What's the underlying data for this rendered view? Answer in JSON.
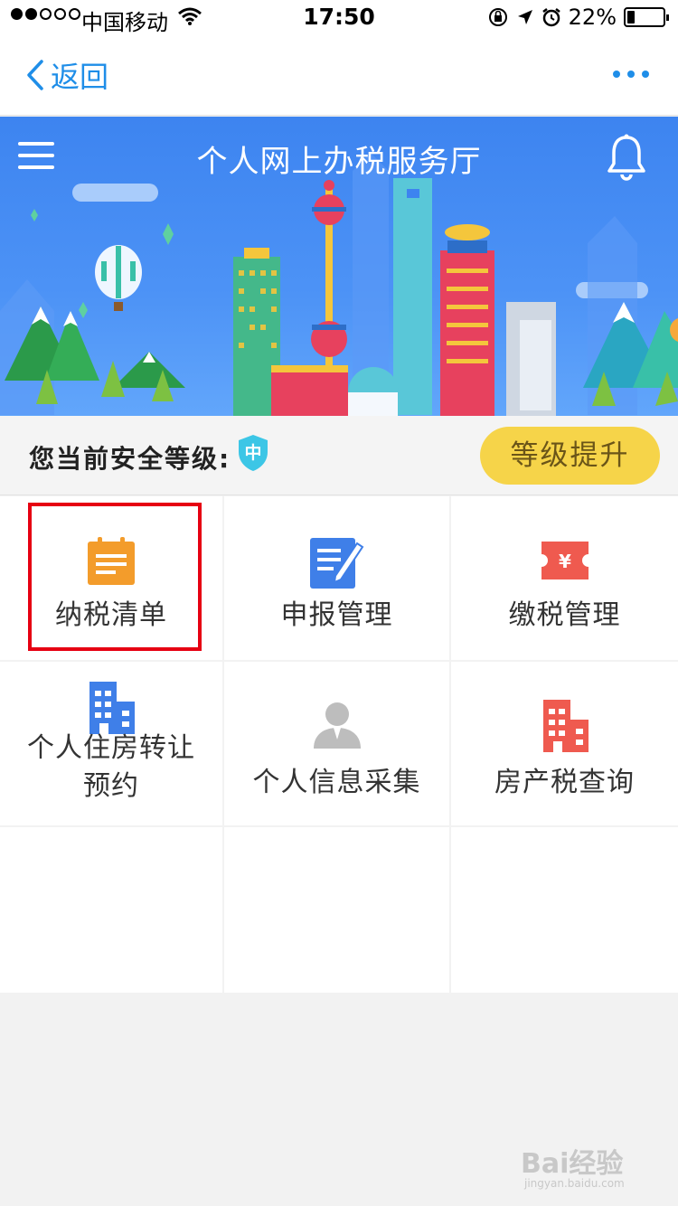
{
  "status_bar": {
    "carrier": "中国移动",
    "time": "17:50",
    "battery": "22%",
    "battery_level": 0.22
  },
  "nav": {
    "back_label": "返回",
    "more_icon": "more-dots-icon"
  },
  "header": {
    "title": "个人网上办税服务厅",
    "menu_icon": "hamburger-menu-icon",
    "bell_icon": "bell-icon"
  },
  "security": {
    "label": "您当前安全等级:",
    "level": "中",
    "upgrade_label": "等级提升"
  },
  "services": [
    {
      "label": "纳税清单",
      "icon": "tax-list-icon",
      "color": "#f39c2b"
    },
    {
      "label": "申报管理",
      "icon": "declaration-edit-icon",
      "color": "#3f7fe8"
    },
    {
      "label": "缴税管理",
      "icon": "yuan-ticket-icon",
      "color": "#ef5a4f"
    },
    {
      "label": "个人住房转让预约",
      "label_line1": "个人住房转让",
      "label_line2": "预约",
      "icon": "building-icon",
      "color": "#3f7fe8"
    },
    {
      "label": "个人信息采集",
      "icon": "person-icon",
      "color": "#bdbdbd"
    },
    {
      "label": "房产税查询",
      "icon": "property-building-icon",
      "color": "#ef5a4f"
    }
  ],
  "watermark": {
    "brand": "Bai经验",
    "url": "jingyan.baidu.com"
  },
  "colors": {
    "accent": "#1f8ee8",
    "banner": "#4a8ef4",
    "upgrade_button": "#f6d449",
    "highlight": "#e60012"
  }
}
